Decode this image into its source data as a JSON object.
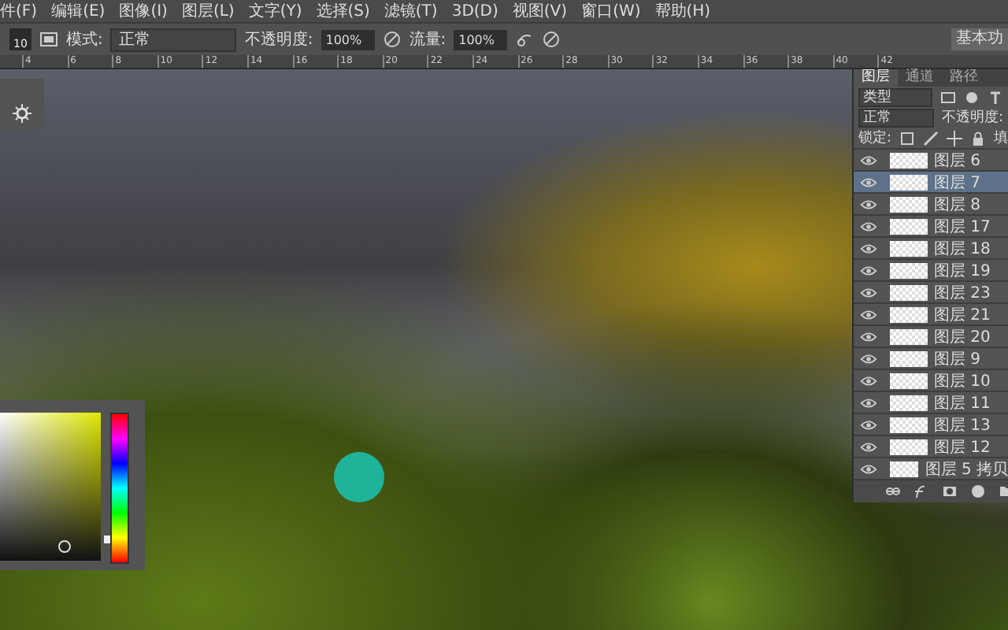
{
  "menu": [
    "件(F)",
    "编辑(E)",
    "图像(I)",
    "图层(L)",
    "文字(Y)",
    "选择(S)",
    "滤镜(T)",
    "3D(D)",
    "视图(V)",
    "窗口(W)",
    "帮助(H)"
  ],
  "options": {
    "brush_size": "10",
    "mode_label": "模式:",
    "mode_value": "正常",
    "opacity_label": "不透明度:",
    "opacity_value": "100%",
    "flow_label": "流量:",
    "flow_value": "100%",
    "workspace": "基本功"
  },
  "color_picker": {
    "hue": {
      "level": 0.15
    }
  },
  "ruler": [
    "4",
    "6",
    "8",
    "10",
    "12",
    "14",
    "16",
    "18",
    "20",
    "22",
    "24",
    "26",
    "28",
    "30",
    "32",
    "34",
    "36",
    "38",
    "40",
    "42"
  ],
  "layers_panel": {
    "tabs": [
      {
        "label": "图层",
        "selected": true
      },
      {
        "label": "通道",
        "selected": false
      },
      {
        "label": "路径",
        "selected": false
      }
    ],
    "filter": "类型",
    "blend": "正常",
    "opacity_label": "不透明度:",
    "lock_label": "锁定:",
    "fill_label": "填",
    "layers": [
      {
        "name": "图层 6",
        "visible": true,
        "selected": false
      },
      {
        "name": "图层 7",
        "visible": true,
        "selected": true
      },
      {
        "name": "图层 8",
        "visible": true,
        "selected": false
      },
      {
        "name": "图层 17",
        "visible": true,
        "selected": false
      },
      {
        "name": "图层 18",
        "visible": true,
        "selected": false
      },
      {
        "name": "图层 19",
        "visible": true,
        "selected": false
      },
      {
        "name": "图层 23",
        "visible": true,
        "selected": false
      },
      {
        "name": "图层 21",
        "visible": true,
        "selected": false
      },
      {
        "name": "图层 20",
        "visible": true,
        "selected": false
      },
      {
        "name": "图层 9",
        "visible": true,
        "selected": false
      },
      {
        "name": "图层 10",
        "visible": true,
        "selected": false
      },
      {
        "name": "图层 11",
        "visible": true,
        "selected": false
      },
      {
        "name": "图层 13",
        "visible": true,
        "selected": false
      },
      {
        "name": "图层 12",
        "visible": true,
        "selected": false
      },
      {
        "name": "图层 5 拷贝",
        "visible": true,
        "selected": false
      }
    ]
  }
}
